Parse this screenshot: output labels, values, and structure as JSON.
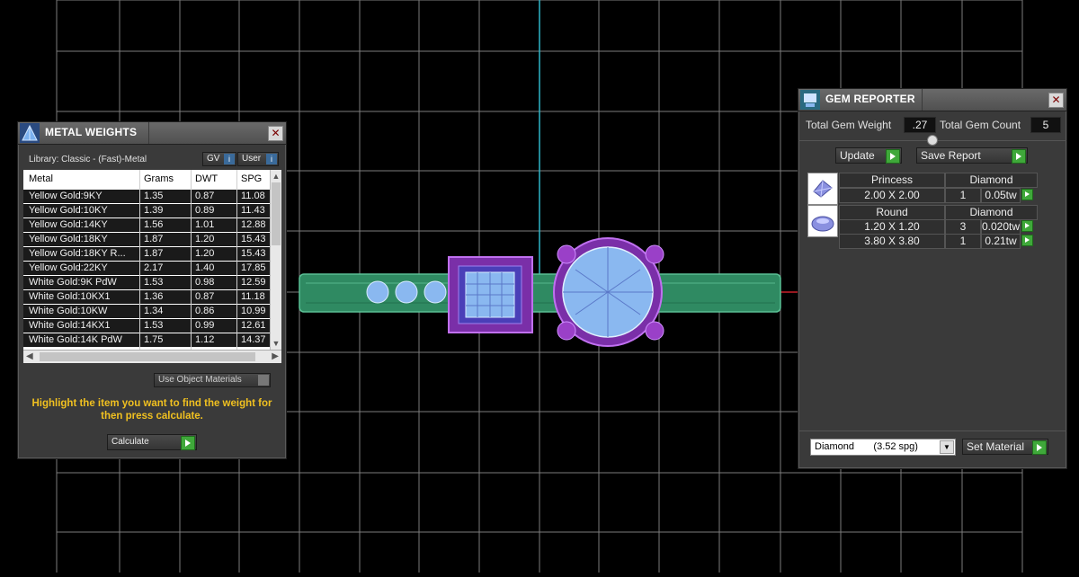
{
  "metal_weights": {
    "title": "METAL WEIGHTS",
    "library_label": "Library: Classic - (Fast)-Metal",
    "gv_label": "GV",
    "user_label": "User",
    "columns": [
      "Metal",
      "Grams",
      "DWT",
      "SPG"
    ],
    "rows": [
      {
        "metal": "Yellow Gold:9KY",
        "grams": "1.35",
        "dwt": "0.87",
        "spg": "11.08"
      },
      {
        "metal": "Yellow Gold:10KY",
        "grams": "1.39",
        "dwt": "0.89",
        "spg": "11.43"
      },
      {
        "metal": "Yellow Gold:14KY",
        "grams": "1.56",
        "dwt": "1.01",
        "spg": "12.88"
      },
      {
        "metal": "Yellow Gold:18KY",
        "grams": "1.87",
        "dwt": "1.20",
        "spg": "15.43"
      },
      {
        "metal": "Yellow Gold:18KY R...",
        "grams": "1.87",
        "dwt": "1.20",
        "spg": "15.43"
      },
      {
        "metal": "Yellow Gold:22KY",
        "grams": "2.17",
        "dwt": "1.40",
        "spg": "17.85"
      },
      {
        "metal": "White Gold:9K PdW",
        "grams": "1.53",
        "dwt": "0.98",
        "spg": "12.59"
      },
      {
        "metal": "White Gold:10KX1",
        "grams": "1.36",
        "dwt": "0.87",
        "spg": "11.18"
      },
      {
        "metal": "White Gold:10KW",
        "grams": "1.34",
        "dwt": "0.86",
        "spg": "10.99"
      },
      {
        "metal": "White Gold:14KX1",
        "grams": "1.53",
        "dwt": "0.99",
        "spg": "12.61"
      },
      {
        "metal": "White Gold:14K PdW",
        "grams": "1.75",
        "dwt": "1.12",
        "spg": "14.37"
      }
    ],
    "use_object_materials_label": "Use Object Materials",
    "instruction": "Highlight the item you want to find the weight for then press calculate.",
    "calculate_label": "Calculate"
  },
  "gem_reporter": {
    "title": "GEM REPORTER",
    "total_weight_label": "Total Gem Weight",
    "total_weight_value": ".27",
    "total_count_label": "Total Gem Count",
    "total_count_value": "5",
    "update_label": "Update",
    "save_report_label": "Save Report",
    "groups": [
      {
        "shape": "Princess",
        "material": "Diamond",
        "icon": "princess-gem-icon",
        "rows": [
          {
            "size": "2.00 X 2.00",
            "count": "1",
            "weight": "0.05tw"
          }
        ]
      },
      {
        "shape": "Round",
        "material": "Diamond",
        "icon": "round-gem-icon",
        "rows": [
          {
            "size": "1.20 X 1.20",
            "count": "3",
            "weight": "0.020tw"
          },
          {
            "size": "3.80 X 3.80",
            "count": "1",
            "weight": "0.21tw"
          }
        ]
      }
    ],
    "material_select_value": "Diamond       (3.52 spg)",
    "set_material_label": "Set Material"
  },
  "colors": {
    "grid": "#8a8a8a",
    "band": "#3f9a6e",
    "setting": "#8a35b8",
    "gem": "#8ab8f0",
    "axis_v": "#2fb6c8",
    "axis_h": "#c8202a",
    "go_button": "#3fa83a"
  }
}
